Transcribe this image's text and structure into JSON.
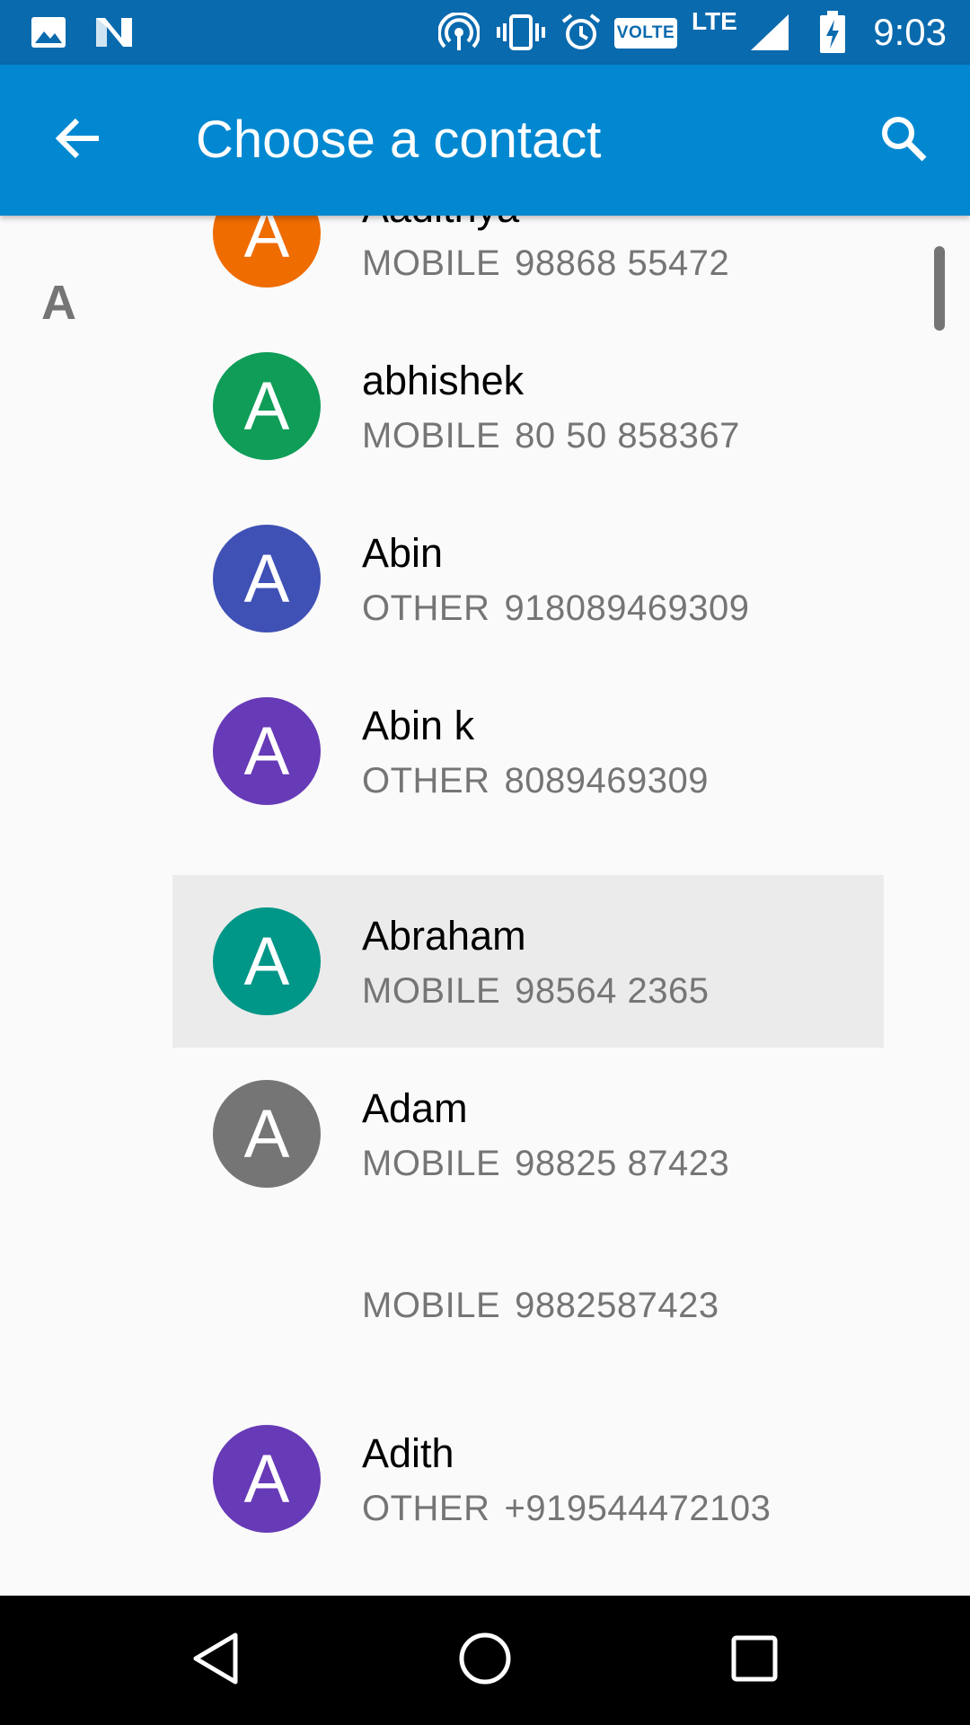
{
  "status_bar": {
    "time": "9:03",
    "volte": "VOLTE",
    "network": "LTE",
    "icons": [
      "image-icon",
      "n-notification-icon",
      "hotspot-icon",
      "vibrate-icon",
      "alarm-icon",
      "signal-icon",
      "battery-charging-icon"
    ]
  },
  "app_bar": {
    "title": "Choose a contact",
    "back_icon": "arrow-back-icon",
    "search_icon": "search-icon",
    "background": "#0288d1"
  },
  "section": {
    "letter": "A"
  },
  "contacts": [
    {
      "name": "Aadithya",
      "phone_type": "MOBILE",
      "phone": "98868 55472",
      "initial": "A",
      "color": "#ef6c00"
    },
    {
      "name": "abhishek",
      "phone_type": "MOBILE",
      "phone": "80 50 858367",
      "initial": "A",
      "color": "#0f9d58"
    },
    {
      "name": "Abin",
      "phone_type": "OTHER",
      "phone": "918089469309",
      "initial": "A",
      "color": "#3f51b5"
    },
    {
      "name": "Abin k",
      "phone_type": "OTHER",
      "phone": "8089469309",
      "initial": "A",
      "color": "#673ab7"
    },
    {
      "name": "Abraham",
      "phone_type": "MOBILE",
      "phone": "98564 2365",
      "initial": "A",
      "color": "#009688",
      "selected": true
    },
    {
      "name": "Adam",
      "phone_type": "MOBILE",
      "phone": "98825 87423",
      "initial": "A",
      "color": "#757575"
    },
    {
      "name": "",
      "phone_type": "MOBILE",
      "phone": "9882587423"
    },
    {
      "name": "Adith",
      "phone_type": "OTHER",
      "phone": "+919544472103",
      "initial": "A",
      "color": "#673ab7"
    }
  ],
  "nav_bar": {
    "icons": [
      "nav-back-icon",
      "nav-home-icon",
      "nav-recents-icon"
    ]
  }
}
